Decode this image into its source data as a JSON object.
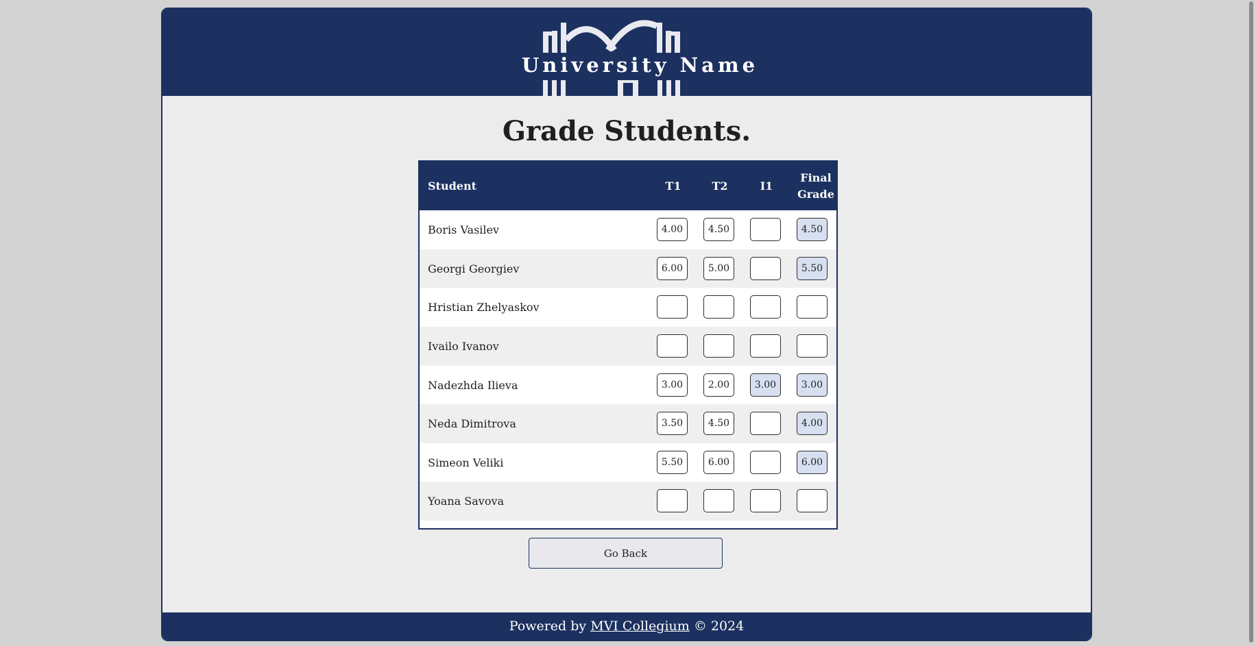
{
  "header": {
    "university_name": "University Name"
  },
  "page_title": "Grade Students.",
  "table": {
    "columns": {
      "student": "Student",
      "t1": "T1",
      "t2": "T2",
      "i1": "I1",
      "final_line1": "Final",
      "final_line2": "Grade"
    },
    "rows": [
      {
        "name": "Boris Vasilev",
        "t1": "4.00",
        "t2": "4.50",
        "i1": "",
        "final": "4.50"
      },
      {
        "name": "Georgi Georgiev",
        "t1": "6.00",
        "t2": "5.00",
        "i1": "",
        "final": "5.50"
      },
      {
        "name": "Hristian Zhelyaskov",
        "t1": "",
        "t2": "",
        "i1": "",
        "final": ""
      },
      {
        "name": "Ivailo Ivanov",
        "t1": "",
        "t2": "",
        "i1": "",
        "final": ""
      },
      {
        "name": "Nadezhda Ilieva",
        "t1": "3.00",
        "t2": "2.00",
        "i1": "3.00",
        "final": "3.00"
      },
      {
        "name": "Neda Dimitrova",
        "t1": "3.50",
        "t2": "4.50",
        "i1": "",
        "final": "4.00"
      },
      {
        "name": "Simeon Veliki",
        "t1": "5.50",
        "t2": "6.00",
        "i1": "",
        "final": "6.00"
      },
      {
        "name": "Yoana Savova",
        "t1": "",
        "t2": "",
        "i1": "",
        "final": ""
      }
    ]
  },
  "go_back_label": "Go Back",
  "footer": {
    "prefix": "Powered by ",
    "link_text": "MVI Collegium",
    "suffix": " © 2024"
  },
  "colors": {
    "brand_navy": "#1c3160",
    "computed_cell": "#d7e0f1",
    "page_background": "#ececec"
  },
  "icons": {
    "logo": "university-building-logo-icon"
  }
}
